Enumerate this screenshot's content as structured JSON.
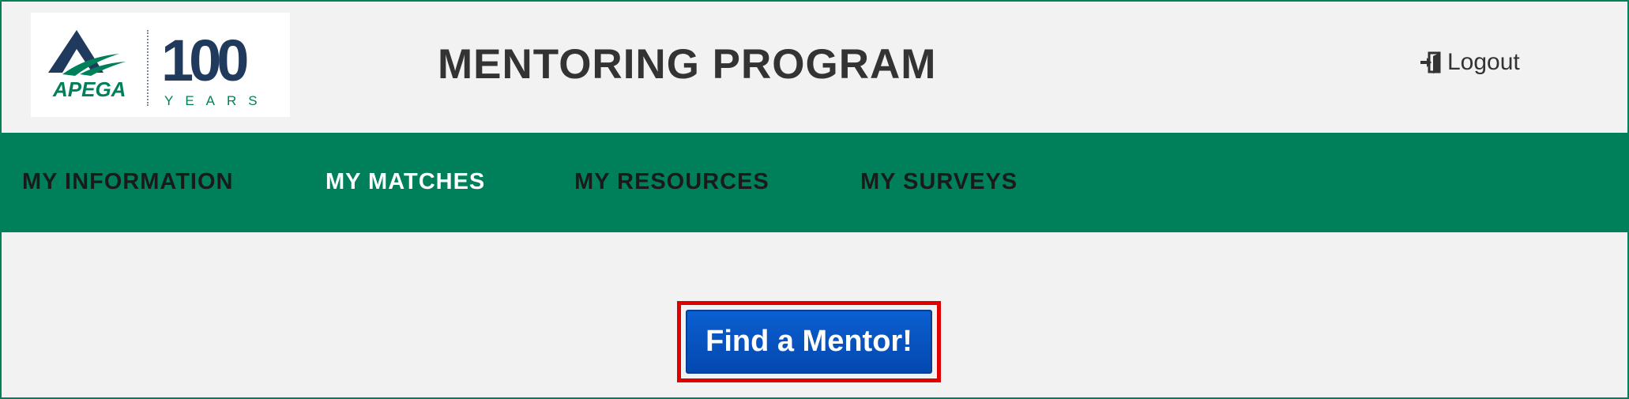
{
  "header": {
    "logo": {
      "brand": "APEGA",
      "anniversary_number": "100",
      "anniversary_word": "YEARS",
      "colors": {
        "green": "#00805a",
        "navy": "#1f3a5c"
      }
    },
    "title": "MENTORING PROGRAM",
    "logout_label": "Logout",
    "logout_icon": "sign-out-icon"
  },
  "nav": {
    "background": "#00805a",
    "items": [
      {
        "label": "MY INFORMATION",
        "active": false
      },
      {
        "label": "MY MATCHES",
        "active": true
      },
      {
        "label": "MY RESOURCES",
        "active": false
      },
      {
        "label": "MY SURVEYS",
        "active": false
      }
    ]
  },
  "main": {
    "cta_label": "Find a Mentor!",
    "cta_color": "#0655c4",
    "highlight_color": "#e00000"
  }
}
